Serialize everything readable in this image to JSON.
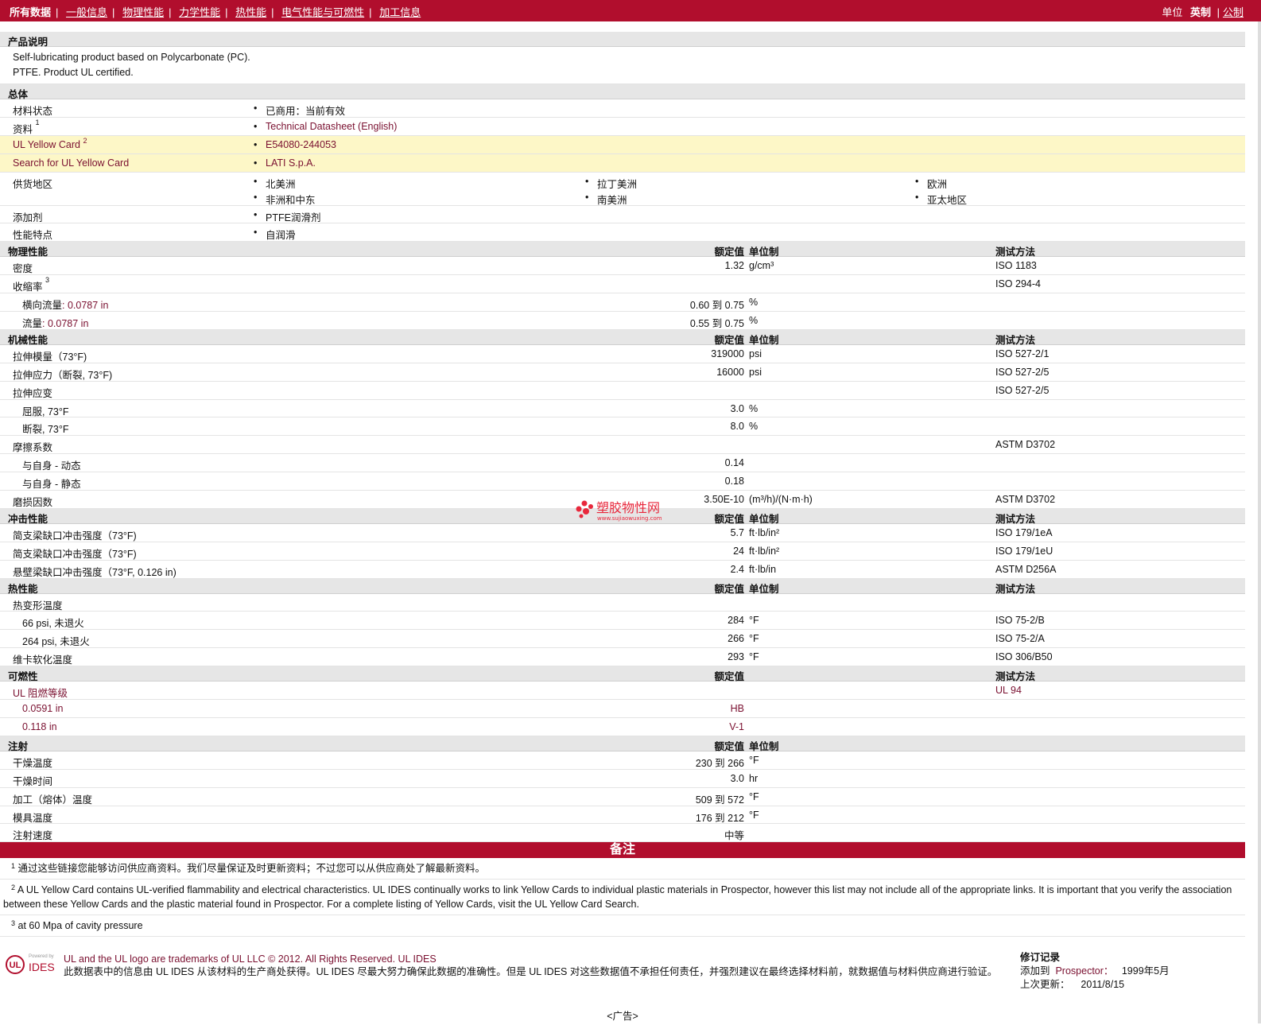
{
  "topnav": {
    "items": [
      "所有数据",
      "一般信息",
      "物理性能",
      "力学性能",
      "热性能",
      "电气性能与可燃性",
      "加工信息"
    ],
    "units_label": "单位",
    "units_active": "英制",
    "units_alt": "公制"
  },
  "description": {
    "header": "产品说明",
    "line1": "Self-lubricating product based on Polycarbonate (PC).",
    "line2": "PTFE. Product UL certified."
  },
  "general": {
    "header": "总体",
    "status_label": "材料状态",
    "status_value": "已商用：当前有效",
    "docs_label": "资料",
    "docs_sup": "1",
    "docs_value": "Technical Datasheet (English)",
    "ulcard_label": "UL Yellow Card",
    "ulcard_sup": "2",
    "ulcard_value": "E54080-244053",
    "search_label": "Search for UL Yellow Card",
    "search_value": "LATI S.p.A.",
    "region_label": "供货地区",
    "regions": [
      "北美洲",
      "拉丁美洲",
      "欧洲",
      "非洲和中东",
      "南美洲",
      "亚太地区"
    ],
    "additive_label": "添加剂",
    "additive_value": "PTFE润滑剂",
    "feature_label": "性能特点",
    "feature_value": "自润滑"
  },
  "physical": {
    "header": "物理性能",
    "col_val": "额定值",
    "col_unit": "单位制",
    "col_test": "测试方法",
    "density_label": "密度",
    "density_val": "1.32",
    "density_unit": "g/cm³",
    "density_test": "ISO 1183",
    "shrink_label": "收缩率",
    "shrink_sup": "3",
    "shrink_test": "ISO 294-4",
    "shrink_t_label": "横向流量",
    "shrink_t_thk": ": 0.0787 in",
    "shrink_t_val": "0.60 到  0.75",
    "shrink_t_unit": "%",
    "shrink_f_label": "流量",
    "shrink_f_thk": ": 0.0787 in",
    "shrink_f_val": "0.55 到  0.75",
    "shrink_f_unit": "%"
  },
  "mechanical": {
    "header": "机械性能",
    "col_val": "额定值",
    "col_unit": "单位制",
    "col_test": "测试方法",
    "rows": [
      {
        "label": "拉伸模量（73°F)",
        "val": "319000",
        "unit": "psi",
        "test": "ISO 527-2/1",
        "sub": false
      },
      {
        "label": "拉伸应力（断裂, 73°F)",
        "val": "16000",
        "unit": "psi",
        "test": "ISO 527-2/5",
        "sub": false
      },
      {
        "label": "拉伸应变",
        "val": "",
        "unit": "",
        "test": "ISO 527-2/5",
        "sub": false
      },
      {
        "label": "屈服, 73°F",
        "val": "3.0",
        "unit": "%",
        "test": "",
        "sub": true
      },
      {
        "label": "断裂, 73°F",
        "val": "8.0",
        "unit": "%",
        "test": "",
        "sub": true
      },
      {
        "label": "摩擦系数",
        "val": "",
        "unit": "",
        "test": "ASTM D3702",
        "sub": false
      },
      {
        "label": "与自身  - 动态",
        "val": "0.14",
        "unit": "",
        "test": "",
        "sub": true
      },
      {
        "label": "与自身  - 静态",
        "val": "0.18",
        "unit": "",
        "test": "",
        "sub": true
      },
      {
        "label": "磨损因数",
        "val": "3.50E-10",
        "unit": "(m³/h)/(N·m·h)",
        "test": "ASTM D3702",
        "sub": false
      }
    ]
  },
  "impact": {
    "header": "冲击性能",
    "col_val": "额定值",
    "col_unit": "单位制",
    "col_test": "测试方法",
    "rows": [
      {
        "label": "简支梁缺口冲击强度（73°F)",
        "val": "5.7",
        "unit": "ft·lb/in²",
        "test": "ISO 179/1eA"
      },
      {
        "label": "简支梁缺口冲击强度（73°F)",
        "val": "24",
        "unit": "ft·lb/in²",
        "test": "ISO 179/1eU"
      },
      {
        "label": "悬壁梁缺口冲击强度（73°F, 0.126 in)",
        "val": "2.4",
        "unit": "ft·lb/in",
        "test": "ASTM D256A"
      }
    ]
  },
  "thermal": {
    "header": "热性能",
    "col_val": "额定值",
    "col_unit": "单位制",
    "col_test": "测试方法",
    "rows": [
      {
        "label": "热变形温度",
        "val": "",
        "unit": "",
        "test": "",
        "sub": false
      },
      {
        "label": "66 psi, 未退火",
        "val": "284",
        "unit": "°F",
        "test": "ISO 75-2/B",
        "sub": true
      },
      {
        "label": "264 psi, 未退火",
        "val": "266",
        "unit": "°F",
        "test": "ISO 75-2/A",
        "sub": true
      },
      {
        "label": "维卡软化温度",
        "val": "293",
        "unit": "°F",
        "test": "ISO 306/B50",
        "sub": false
      }
    ]
  },
  "flammability": {
    "header": "可燃性",
    "col_val": "额定值",
    "col_test": "测试方法",
    "rating_label": "UL 阻燃等级",
    "rating_test": "UL 94",
    "rows": [
      {
        "label": "0.0591 in",
        "val": "HB"
      },
      {
        "label": "0.118 in",
        "val": "V-1"
      }
    ]
  },
  "injection": {
    "header": "注射",
    "col_val": "额定值",
    "col_unit": "单位制",
    "rows": [
      {
        "label": "干燥温度",
        "val": "230 到  266",
        "unit": "°F"
      },
      {
        "label": "干燥时间",
        "val": "3.0",
        "unit": "hr"
      },
      {
        "label": "加工（熔体）温度",
        "val": "509 到  572",
        "unit": "°F"
      },
      {
        "label": "模具温度",
        "val": "176 到  212",
        "unit": "°F"
      },
      {
        "label": "注射速度",
        "val": "中等",
        "unit": ""
      }
    ]
  },
  "notes": {
    "header": "备注",
    "n1_num": "1",
    "n1": "通过这些链接您能够访问供应商资料。我们尽量保证及时更新资料；不过您可以从供应商处了解最新资料。",
    "n2_num": "2",
    "n2": "A UL Yellow Card contains UL-verified flammability and electrical characteristics. UL IDES continually works to link Yellow Cards to individual plastic materials in Prospector, however this list may not include all of the appropriate links. It is important that you verify the association between these Yellow Cards and the plastic material found in Prospector. For a complete listing of Yellow Cards, visit the UL Yellow Card Search.",
    "n3_num": "3",
    "n3": "at 60 Mpa of cavity pressure"
  },
  "footer": {
    "logo_powered": "Powered by",
    "logo_text": "IDES",
    "trademark": "UL and the UL logo are trademarks of UL LLC © 2012. All Rights Reserved. UL IDES",
    "disclaimer": "此数据表中的信息由 UL IDES 从该材料的生产商处获得。UL IDES 尽最大努力确保此数据的准确性。但是 UL IDES 对这些数据值不承担任何责任，并强烈建议在最终选择材料前，就数据值与材料供应商进行验证。",
    "rev_title": "修订记录",
    "rev_added_label": "添加到",
    "rev_added_where": "Prospector：",
    "rev_added_date": "1999年5月",
    "rev_updated_label": "上次更新：",
    "rev_updated_date": "2011/8/15",
    "ad": "<广告>"
  },
  "watermark": {
    "name": "塑胶物性网",
    "url": "www.sujiaowuxing.com",
    "color": "#e8283c"
  },
  "colors": {
    "brand": "#b10e2d",
    "link": "#7a1030",
    "highlight": "#fdf7c7"
  }
}
